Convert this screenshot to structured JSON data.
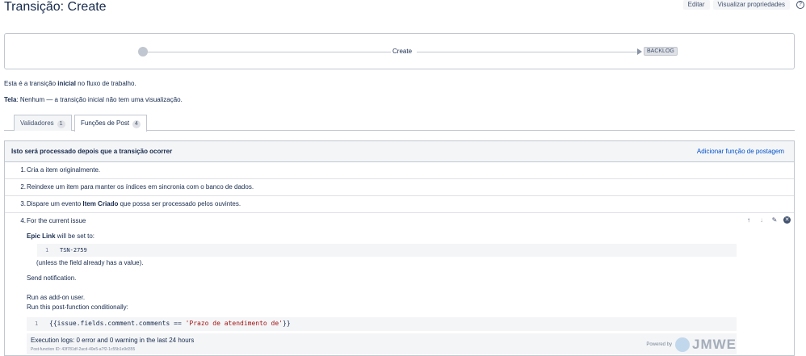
{
  "header": {
    "title": "Transição: Create",
    "edit_label": "Editar",
    "view_props_label": "Visualizar propriedades",
    "help_glyph": "?"
  },
  "diagram": {
    "transition_label": "Create",
    "target_status": "BACKLOG"
  },
  "info": {
    "line1_pre": "Esta é a transição ",
    "line1_bold": "inicial",
    "line1_post": " no fluxo de trabalho.",
    "line2_bold": "Tela",
    "line2_post": ": Nenhum — a transição inicial não tem uma visualização."
  },
  "tabs": [
    {
      "label": "Validadores",
      "count": "1"
    },
    {
      "label": "Funções de Post",
      "count": "4"
    }
  ],
  "table": {
    "header": "Isto será processado depois que a transição ocorrer",
    "add_link": "Adicionar função de postagem",
    "rows": [
      {
        "num": "1.",
        "text": "Cria a item originalmente."
      },
      {
        "num": "2.",
        "text": "Reindexe um item para manter os índices em sincronia com o banco de dados."
      },
      {
        "num": "3.",
        "pre": "Dispare um evento ",
        "bold": "Item Criado",
        "post": " que possa ser processado pelos ouvintes."
      }
    ],
    "row4": {
      "num": "4.",
      "line1": "For the current issue",
      "field_bold": "Epic Link",
      "field_post": " will be set to:",
      "code1_line": "1",
      "code1_text": "TSN-2759",
      "unless": "(unless the field already has a value).",
      "send": "Send notification.",
      "run_as": "Run as add-on user.",
      "run_cond": "Run this post-function conditionally:",
      "code2_line": "1",
      "code2_pre": "{{issue.fields.comment.comments == ",
      "code2_str": "'Prazo de atendimento de'",
      "code2_post": "}}",
      "logs": "Execution logs: 0 error and 0 warning in the last 24 hours",
      "postfn_id": "Post-function ID: 43f781df-2acd-40e5-a7f2-1c55b1e9d355",
      "powered_by": "Powered by",
      "brand": "JMWE"
    }
  }
}
